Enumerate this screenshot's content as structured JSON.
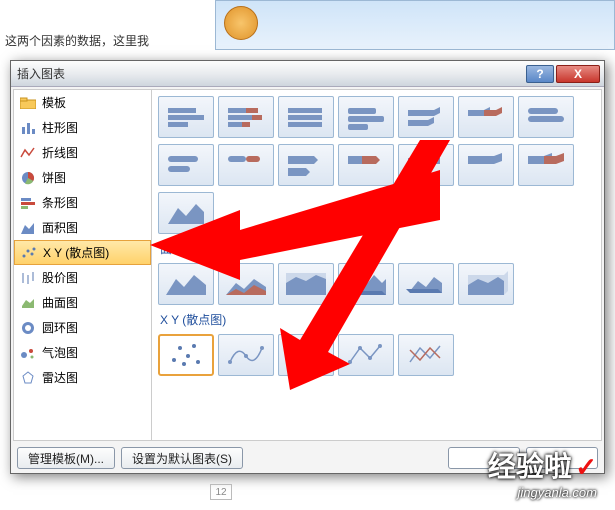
{
  "bg_text": "这两个因素的数据，这里我",
  "dialog": {
    "title": "插入图表",
    "help": "?",
    "close": "X",
    "sidebar": [
      {
        "label": "模板",
        "icon": "folder"
      },
      {
        "label": "柱形图",
        "icon": "column"
      },
      {
        "label": "折线图",
        "icon": "line"
      },
      {
        "label": "饼图",
        "icon": "pie"
      },
      {
        "label": "条形图",
        "icon": "bar"
      },
      {
        "label": "面积图",
        "icon": "area"
      },
      {
        "label": "X Y (散点图)",
        "icon": "scatter",
        "selected": true
      },
      {
        "label": "股价图",
        "icon": "stock"
      },
      {
        "label": "曲面图",
        "icon": "surface"
      },
      {
        "label": "圆环图",
        "icon": "doughnut"
      },
      {
        "label": "气泡图",
        "icon": "bubble"
      },
      {
        "label": "雷达图",
        "icon": "radar"
      }
    ],
    "sections": {
      "area": "面积图",
      "scatter": "X Y (散点图)"
    },
    "footer": {
      "manage": "管理模板(M)...",
      "default": "设置为默认图表(S)"
    }
  },
  "page_num": "12",
  "watermark": {
    "big": "经验啦",
    "small": "jingyanla.com"
  }
}
